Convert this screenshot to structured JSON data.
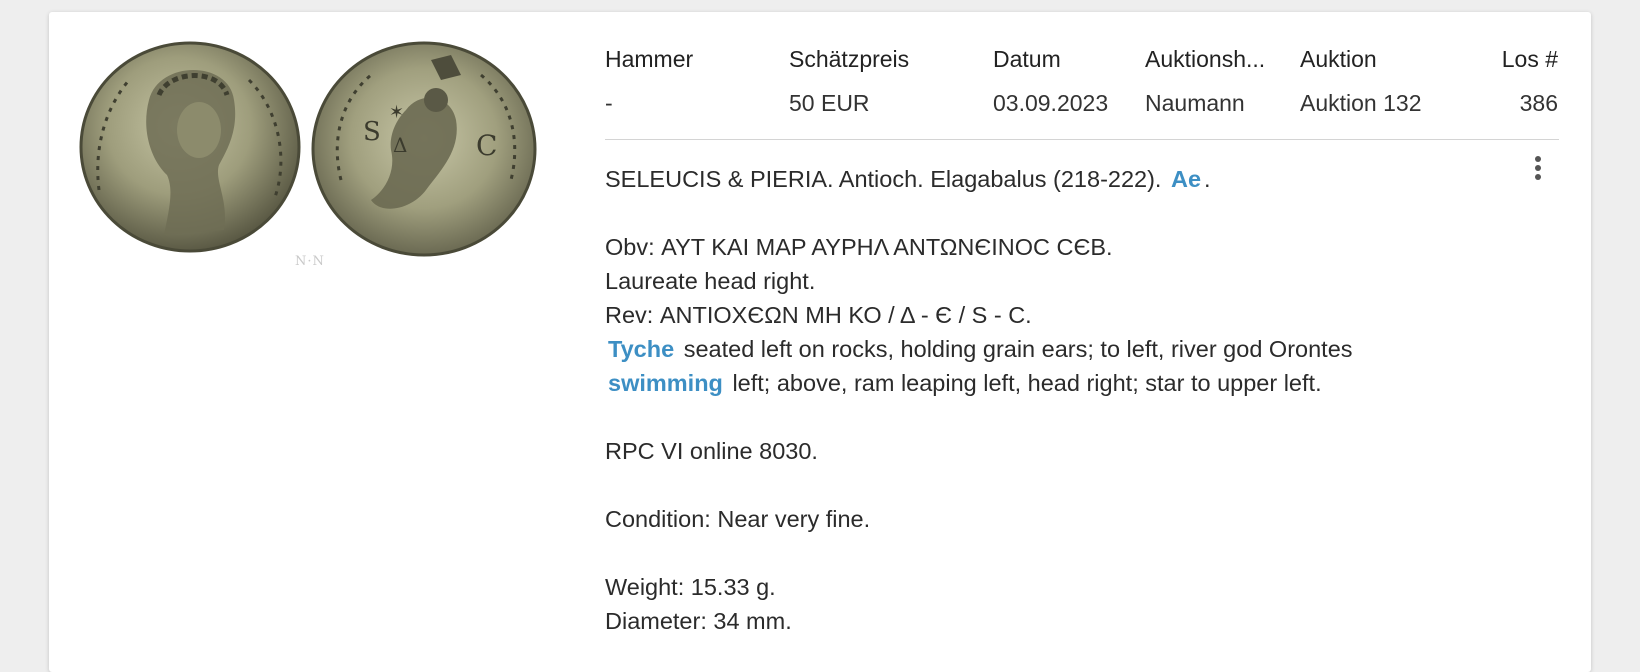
{
  "table": {
    "headers": {
      "hammer": "Hammer",
      "estimate": "Schätzpreis",
      "date": "Datum",
      "auction_house": "Auktionsh...",
      "auction": "Auktion",
      "lot": "Los #"
    },
    "values": {
      "hammer": "-",
      "estimate": "50 EUR",
      "date": "03.09.2023",
      "auction_house": "Naumann",
      "auction": "Auktion 132",
      "lot": "386"
    }
  },
  "description": {
    "title_text": "SELEUCIS & PIERIA. Antioch. Elagabalus (218-222).",
    "title_link": "Ae",
    "title_end": ".",
    "obverse_legend": "Obv: ΑΥΤ ΚΑΙ ΜΑΡ ΑΥΡΗΛ ΑΝΤΩΝЄΙΝΟϹ ϹЄΒ.",
    "obverse_desc": "Laureate head right.",
    "reverse_legend": "Rev: ΑΝΤΙΟΧЄΩΝ ΜΗ ΚΟ / Δ - Є / S - C.",
    "tyche_link": "Tyche",
    "tyche_text": "seated left on rocks, holding grain ears; to left, river god Orontes",
    "swimming_link": "swimming",
    "swimming_text": "left; above, ram leaping left, head right; star to upper left.",
    "reference": "RPC VI online 8030.",
    "condition": "Condition: Near very fine.",
    "weight": "Weight: 15.33 g.",
    "diameter": "Diameter: 34 mm."
  },
  "image": {
    "watermark": "N·N",
    "obverse_name": "coin-obverse",
    "reverse_name": "coin-reverse"
  },
  "colors": {
    "link": "#3d8fc4",
    "coin_base": "#8a8a66",
    "coin_dark": "#4a4a38"
  },
  "icons": {
    "menu": "more-vert-icon"
  }
}
